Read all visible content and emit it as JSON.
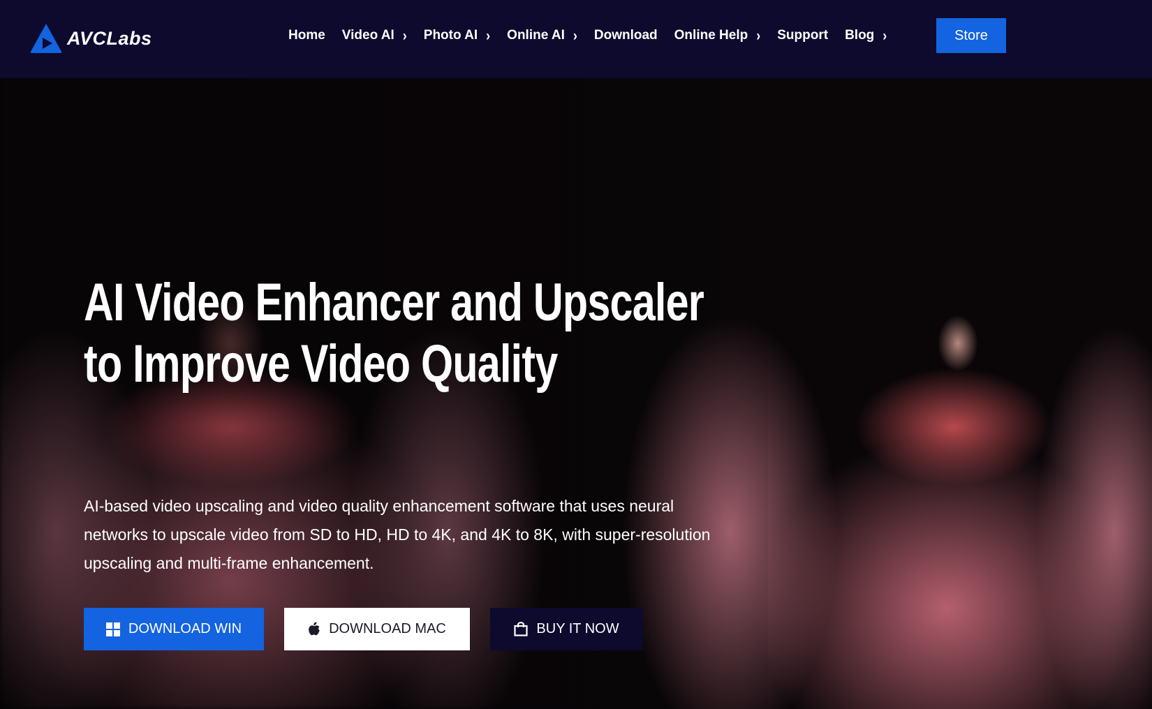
{
  "brand": {
    "name": "AVCLabs",
    "color": "#1463e0"
  },
  "nav": {
    "items": [
      {
        "label": "Home",
        "has_submenu": false
      },
      {
        "label": "Video AI",
        "has_submenu": true
      },
      {
        "label": "Photo AI",
        "has_submenu": true
      },
      {
        "label": "Online AI",
        "has_submenu": true
      },
      {
        "label": "Download",
        "has_submenu": false
      },
      {
        "label": "Online Help",
        "has_submenu": true
      },
      {
        "label": "Support",
        "has_submenu": false
      },
      {
        "label": "Blog",
        "has_submenu": true
      }
    ],
    "store_label": "Store",
    "background": "#0d0a2e"
  },
  "hero": {
    "title_line1": "AI Video Enhancer and Upscaler",
    "title_line2": "to Improve Video Quality",
    "description": "AI-based video upscaling and video quality enhancement software that uses neural networks to upscale video from SD to HD, HD to 4K, and 4K to 8K, with super-resolution upscaling and multi-frame enhancement.",
    "buttons": {
      "download_win": {
        "label": "DOWNLOAD WIN",
        "icon": "windows-icon"
      },
      "download_mac": {
        "label": "DOWNLOAD MAC",
        "icon": "apple-icon"
      },
      "buy_now": {
        "label": "BUY IT NOW",
        "icon": "shopping-bag-icon"
      }
    }
  }
}
